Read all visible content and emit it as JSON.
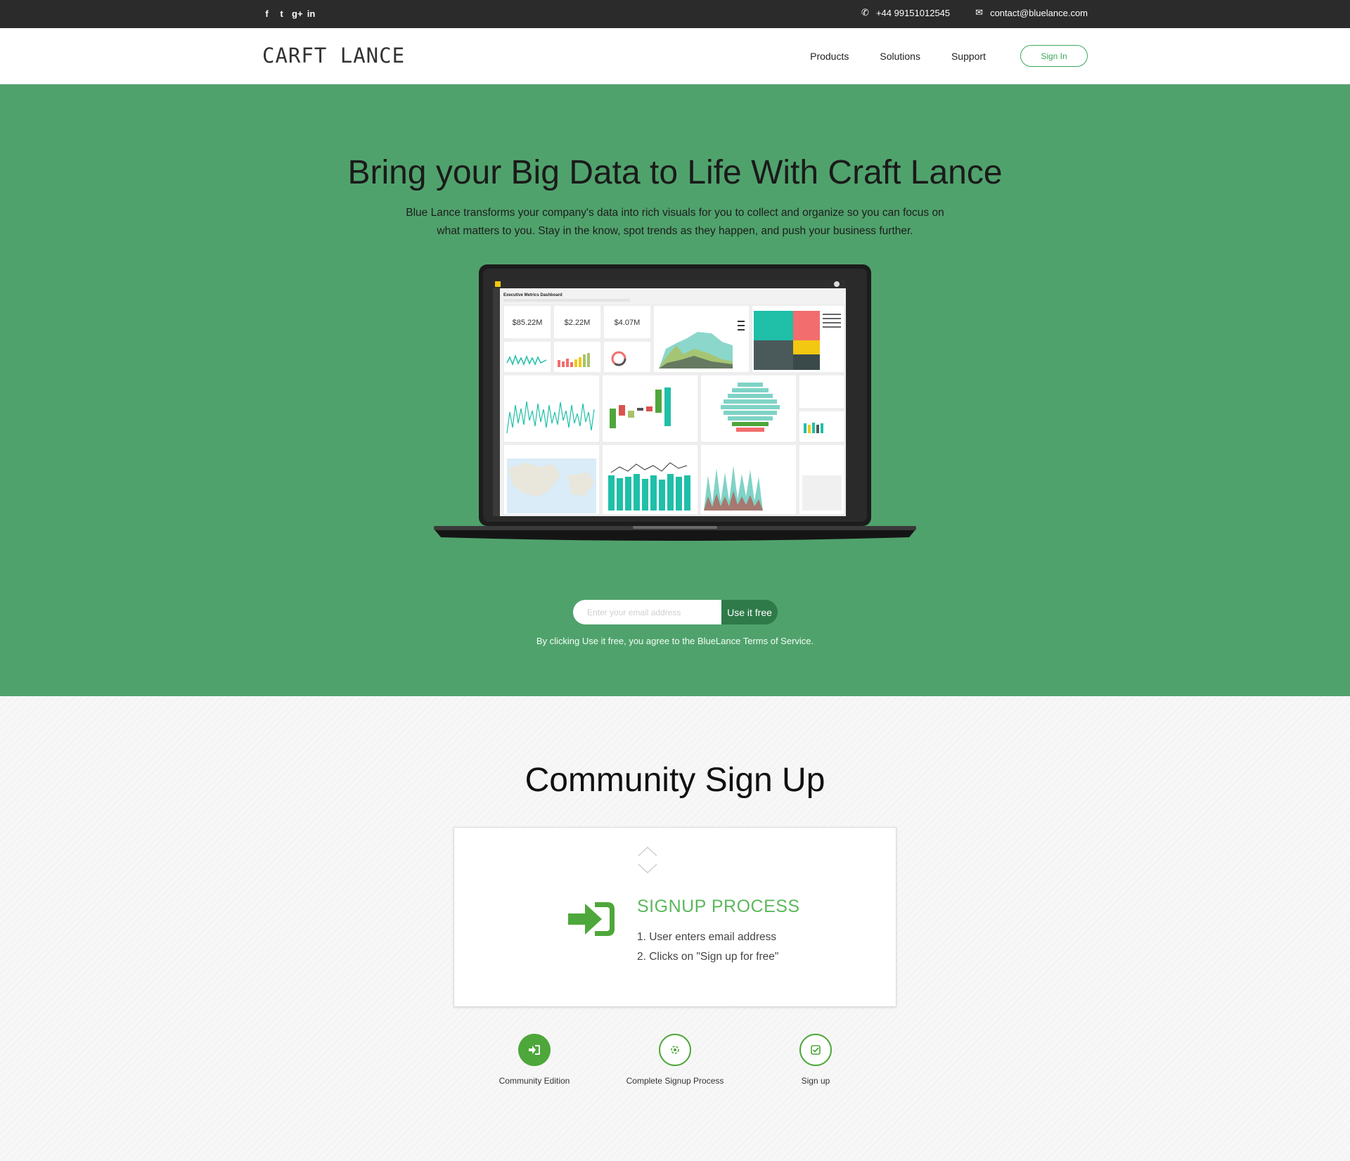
{
  "topbar": {
    "social": [
      "f",
      "t",
      "g+",
      "in"
    ],
    "phone": "+44 99151012545",
    "email": "contact@bluelance.com",
    "icons": [
      "facebook-icon",
      "twitter-icon",
      "google-plus-icon",
      "linkedin-icon",
      "phone-icon",
      "envelope-icon"
    ]
  },
  "header": {
    "logo": "CARFT LANCE",
    "nav": [
      "Products",
      "Solutions",
      "Support"
    ],
    "signin": "Sign In"
  },
  "hero": {
    "title": "Bring your Big Data to Life With Craft Lance",
    "subtitle": "Blue Lance transforms your company's data into rich visuals for you to collect and organize so you can focus on what matters to you. Stay in the know, spot trends as they happen, and push your business further.",
    "email_placeholder": "Enter your email address",
    "cta": "Use it free",
    "terms": "By clicking Use it free, you agree to the  BlueLance Terms of Service.",
    "dashboard": {
      "title": "Executive Metrics Dashboard",
      "kpis": [
        "$85.22M",
        "$2.22M",
        "$4.07M"
      ]
    }
  },
  "community": {
    "title": "Community Sign Up",
    "process_title": "SIGNUP PROCESS",
    "steps": [
      "1.  User enters email address",
      "2. Clicks on \"Sign up for free\""
    ],
    "bottom_steps": [
      {
        "label": "Community Edition",
        "icon": "sign-in-icon"
      },
      {
        "label": "Complete Signup Process",
        "icon": "user-settings-icon"
      },
      {
        "label": "Sign up",
        "icon": "check-square-icon"
      }
    ]
  },
  "colors": {
    "hero_bg": "#50a26c",
    "accent": "#4ea73a",
    "topbar_bg": "#2b2b2b",
    "cta_bg": "#2e7a49"
  }
}
